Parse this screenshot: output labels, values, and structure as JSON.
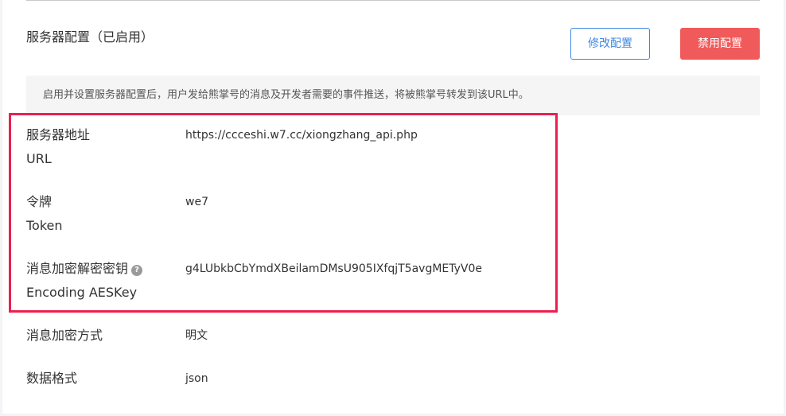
{
  "section": {
    "title": "服务器配置（已启用）",
    "edit_button": "修改配置",
    "disable_button": "禁用配置",
    "notice": "启用并设置服务器配置后，用户发给熊掌号的消息及开发者需要的事件推送，将被熊掌号转发到该URL中。"
  },
  "fields": {
    "url": {
      "label": "服务器地址",
      "sublabel": "URL",
      "value": "https://ccceshi.w7.cc/xiongzhang_api.php"
    },
    "token": {
      "label": "令牌",
      "sublabel": "Token",
      "value": "we7"
    },
    "aeskey": {
      "label": "消息加密解密密钥",
      "sublabel": "Encoding AESKey",
      "value": "g4LUbkbCbYmdXBeilamDMsU905IXfqjT5avgMETyV0e",
      "help_glyph": "?"
    },
    "encrypt_mode": {
      "label": "消息加密方式",
      "value": "明文"
    },
    "data_format": {
      "label": "数据格式",
      "value": "json"
    }
  },
  "colors": {
    "primary": "#3e88e3",
    "danger": "#f05a5a",
    "highlight": "#ec1f4d"
  }
}
